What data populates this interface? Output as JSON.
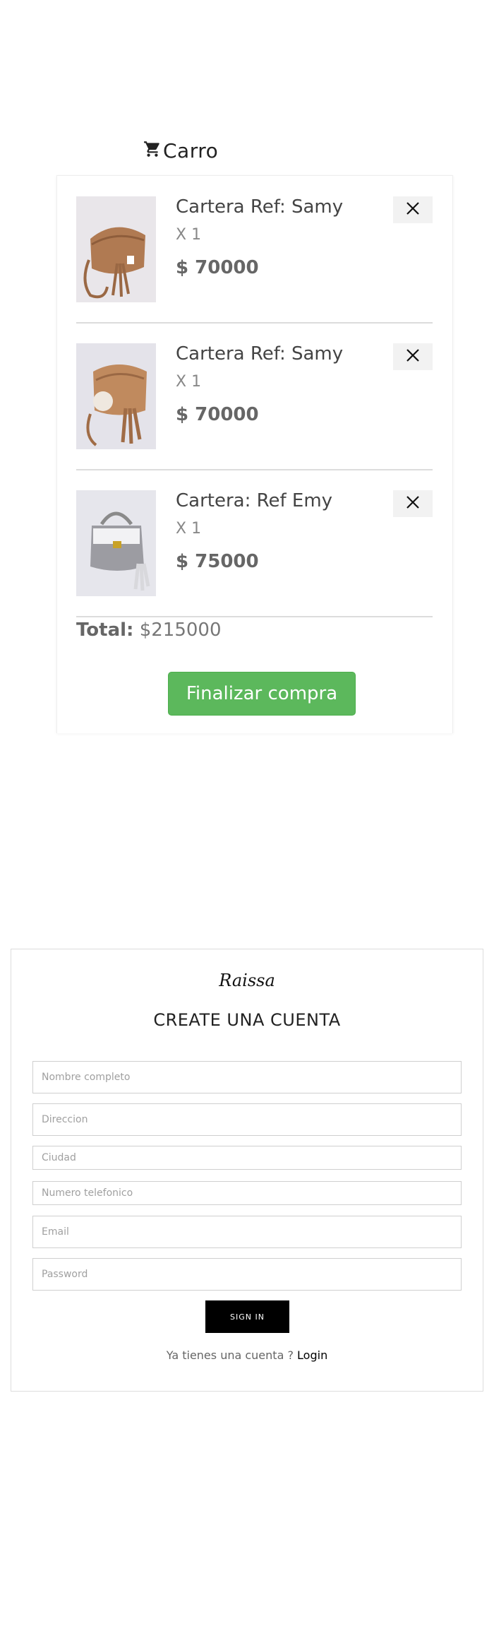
{
  "cart": {
    "title": "Carro",
    "items": [
      {
        "name": "Cartera Ref: Samy",
        "qty": "X 1",
        "price": "$ 70000"
      },
      {
        "name": "Cartera Ref: Samy",
        "qty": "X 1",
        "price": "$ 70000"
      },
      {
        "name": "Cartera: Ref Emy",
        "qty": "X 1",
        "price": "$ 75000"
      }
    ],
    "total_label": "Total:",
    "total_value": "$215000",
    "checkout_label": "Finalizar compra"
  },
  "account": {
    "logo": "Raissa",
    "title": "CREATE UNA CUENTA",
    "fields": {
      "fullname": "Nombre completo",
      "address": "Direccion",
      "city": "Ciudad",
      "phone": "Numero telefonico",
      "email": "Email",
      "password": "Password"
    },
    "signin_label": "SIGN IN",
    "have_account": "Ya tienes una cuenta ?",
    "login_link": "Login"
  },
  "colors": {
    "checkout_green": "#5cb85c",
    "signin_black": "#000000"
  },
  "icons": {
    "cart": "shopping-cart-icon",
    "remove": "close-icon",
    "product_bag_brown": "brown-crochet-bag-photo",
    "product_bag_grey": "grey-white-crochet-bag-photo"
  }
}
